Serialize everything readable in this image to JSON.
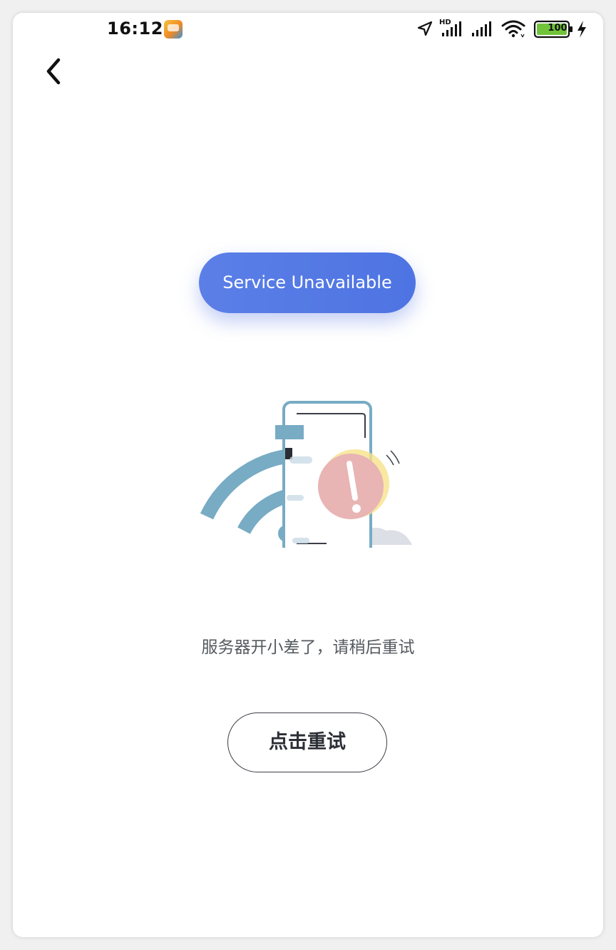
{
  "status_bar": {
    "time": "16:12",
    "battery": "100",
    "icons": [
      "app-icon",
      "location-icon",
      "hd-signal-icon",
      "signal-icon",
      "wifi-icon",
      "battery-icon",
      "charging-icon"
    ]
  },
  "nav": {
    "back_icon": "chevron-left-icon"
  },
  "error": {
    "badge": "Service Unavailable",
    "illustration_icon": "phone-wifi-error-illustration",
    "message": "服务器开小差了，请稍后重试",
    "retry_label": "点击重试"
  },
  "colors": {
    "badge": "#4e74e3",
    "wifi_arcs": "#78abc4",
    "alert_circle": "#e8b4b4",
    "text_muted": "#555a60"
  }
}
